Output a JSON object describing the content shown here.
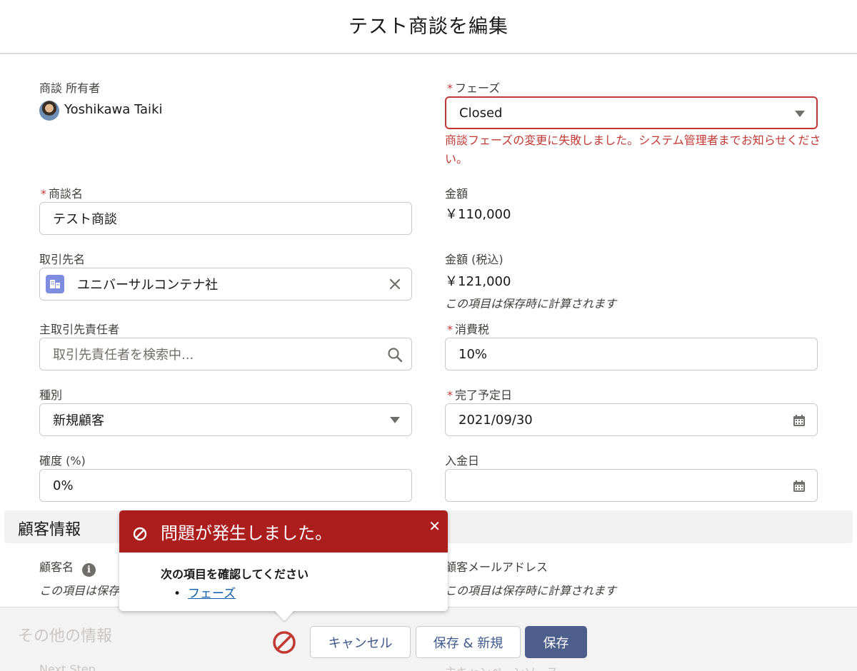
{
  "header": {
    "title": "テスト商談を編集"
  },
  "owner": {
    "label": "商談 所有者",
    "name": "Yoshikawa Taiki"
  },
  "phase": {
    "label": "フェーズ",
    "value": "Closed",
    "error": "商談フェーズの変更に失敗しました。システム管理者までお知らせください。"
  },
  "opportunity_name": {
    "label": "商談名",
    "value": "テスト商談"
  },
  "amount": {
    "label": "金額",
    "value": "￥110,000"
  },
  "account_name": {
    "label": "取引先名",
    "value": "ユニバーサルコンテナ社"
  },
  "amount_tax": {
    "label": "金額 (税込)",
    "value": "￥121,000",
    "note": "この項目は保存時に計算されます"
  },
  "primary_contact": {
    "label": "主取引先責任者",
    "placeholder": "取引先責任者を検索中..."
  },
  "tax": {
    "label": "消費税",
    "value": "10%"
  },
  "type": {
    "label": "種別",
    "value": "新規顧客"
  },
  "close_date": {
    "label": "完了予定日",
    "value": "2021/09/30"
  },
  "probability": {
    "label": "確度 (%)",
    "value": "0%"
  },
  "payment_date": {
    "label": "入金日",
    "value": ""
  },
  "customer_section": {
    "title": "顧客情報",
    "customer_name_label": "顧客名",
    "customer_name_note": "この項目は保存",
    "customer_email_label": "顧客メールアドレス",
    "customer_email_note": "この項目は保存時に計算されます"
  },
  "other_section": {
    "title": "その他の情報",
    "next_step": "Next Step",
    "campaign_source": "主キャンペーンソース"
  },
  "error_popover": {
    "title": "問題が発生しました。",
    "subtitle": "次の項目を確認してください",
    "fields": [
      "フェーズ"
    ]
  },
  "footer": {
    "cancel": "キャンセル",
    "save_new": "保存 & 新規",
    "save": "保存"
  },
  "colors": {
    "error": "#c23934",
    "error_header": "#ac1d1e",
    "brand": "#4d5d8c",
    "link": "#0b5cab"
  }
}
